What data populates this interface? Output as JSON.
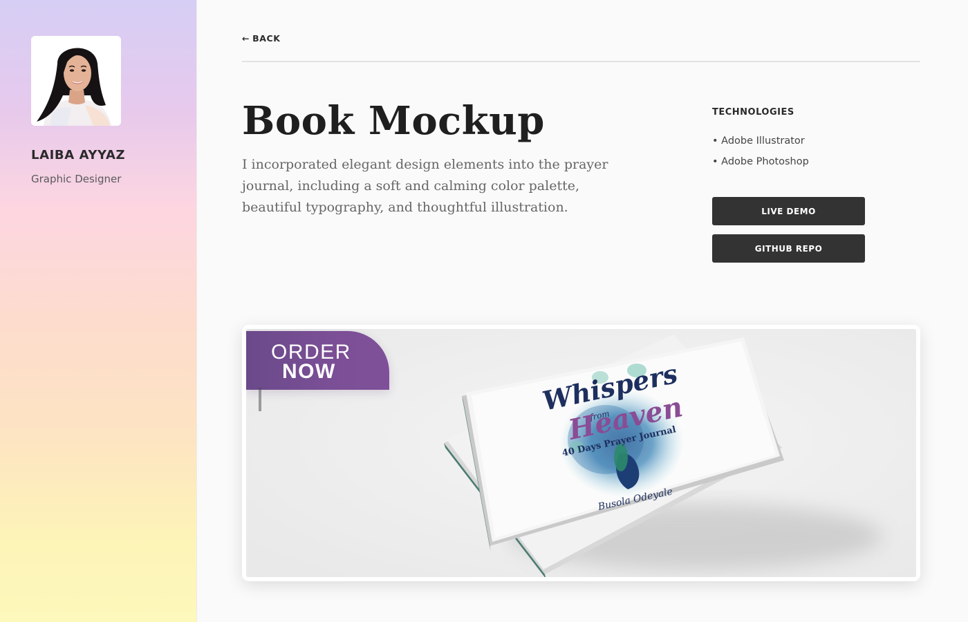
{
  "sidebar": {
    "name": "LAIBA AYYAZ",
    "role": "Graphic Designer"
  },
  "nav": {
    "back_label": "BACK",
    "back_icon": "arrow-left-icon"
  },
  "project": {
    "title": "Book Mockup",
    "description": "I incorporated elegant design elements into the prayer journal, including a soft and calming color palette, beautiful typography, and thoughtful illustration."
  },
  "technologies": {
    "heading": "TECHNOLOGIES",
    "items": [
      "• Adobe Illustrator",
      "• Adobe Photoshop"
    ]
  },
  "buttons": {
    "live_demo": "LIVE DEMO",
    "github_repo": "GITHUB REPO"
  },
  "showcase": {
    "ribbon_line1": "ORDER",
    "ribbon_line2": "NOW",
    "book_title_line1": "Whispers",
    "book_title_from": "from",
    "book_title_line2": "Heaven",
    "book_subtitle": "40 Days Prayer Journal",
    "book_author": "Busola Odeyale"
  },
  "colors": {
    "button_bg": "#333333",
    "ribbon": "#7b4f96",
    "title_navy": "#1d2f5e",
    "title_purple": "#8a4c94"
  }
}
